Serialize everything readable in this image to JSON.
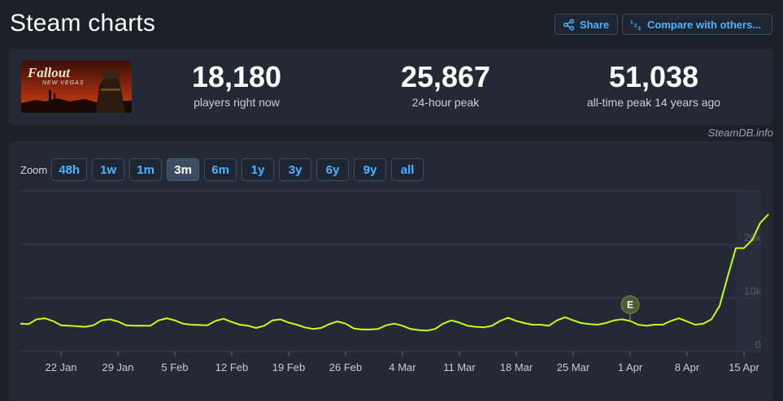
{
  "page": {
    "title": "Steam charts"
  },
  "header": {
    "share_label": "Share",
    "compare_label": "Compare with others..."
  },
  "game": {
    "cover_logo_text": "Fallout",
    "cover_sub_text": "NEW VEGAS"
  },
  "stats": [
    {
      "value": "18,180",
      "label": "players right now"
    },
    {
      "value": "25,867",
      "label": "24-hour peak"
    },
    {
      "value": "51,038",
      "label": "all-time peak 14 years ago"
    }
  ],
  "credit": "SteamDB.info",
  "zoom": {
    "label": "Zoom",
    "options": [
      "48h",
      "1w",
      "1m",
      "3m",
      "6m",
      "1y",
      "3y",
      "6y",
      "9y",
      "all"
    ],
    "active": "3m"
  },
  "colors": {
    "accent": "#4db3ff",
    "line": "#c6ff1a",
    "marker": "#4a5e32"
  },
  "chart_data": {
    "type": "line",
    "x_ticks": [
      "22 Jan",
      "29 Jan",
      "5 Feb",
      "12 Feb",
      "19 Feb",
      "26 Feb",
      "4 Mar",
      "11 Mar",
      "18 Mar",
      "25 Mar",
      "1 Apr",
      "8 Apr",
      "15 Apr"
    ],
    "y_ticks": [
      "0",
      "10k",
      "20k"
    ],
    "ylim": [
      0,
      30000
    ],
    "grid": true,
    "x_start": "2024-01-17",
    "series": [
      {
        "points": [
          [
            "2024-01-17",
            5200
          ],
          [
            "2024-01-18",
            5100
          ],
          [
            "2024-01-19",
            6000
          ],
          [
            "2024-01-20",
            6200
          ],
          [
            "2024-01-21",
            5700
          ],
          [
            "2024-01-22",
            4900
          ],
          [
            "2024-01-23",
            4800
          ],
          [
            "2024-01-25",
            4600
          ],
          [
            "2024-01-26",
            4900
          ],
          [
            "2024-01-27",
            5800
          ],
          [
            "2024-01-28",
            6000
          ],
          [
            "2024-01-29",
            5600
          ],
          [
            "2024-01-30",
            4900
          ],
          [
            "2024-01-31",
            4800
          ],
          [
            "2024-02-02",
            4800
          ],
          [
            "2024-02-03",
            5800
          ],
          [
            "2024-02-04",
            6200
          ],
          [
            "2024-02-05",
            5800
          ],
          [
            "2024-02-06",
            5200
          ],
          [
            "2024-02-07",
            5000
          ],
          [
            "2024-02-09",
            4900
          ],
          [
            "2024-02-10",
            5700
          ],
          [
            "2024-02-11",
            6100
          ],
          [
            "2024-02-12",
            5500
          ],
          [
            "2024-02-13",
            5000
          ],
          [
            "2024-02-14",
            4800
          ],
          [
            "2024-02-15",
            4400
          ],
          [
            "2024-02-16",
            4800
          ],
          [
            "2024-02-17",
            5800
          ],
          [
            "2024-02-18",
            6000
          ],
          [
            "2024-02-19",
            5400
          ],
          [
            "2024-02-20",
            5000
          ],
          [
            "2024-02-21",
            4500
          ],
          [
            "2024-02-22",
            4200
          ],
          [
            "2024-02-23",
            4400
          ],
          [
            "2024-02-24",
            5100
          ],
          [
            "2024-02-25",
            5600
          ],
          [
            "2024-02-26",
            5200
          ],
          [
            "2024-02-27",
            4300
          ],
          [
            "2024-02-28",
            4100
          ],
          [
            "2024-02-29",
            4100
          ],
          [
            "2024-03-01",
            4200
          ],
          [
            "2024-03-02",
            4900
          ],
          [
            "2024-03-03",
            5200
          ],
          [
            "2024-03-04",
            4800
          ],
          [
            "2024-03-05",
            4200
          ],
          [
            "2024-03-06",
            4000
          ],
          [
            "2024-03-07",
            3900
          ],
          [
            "2024-03-08",
            4200
          ],
          [
            "2024-03-09",
            5200
          ],
          [
            "2024-03-10",
            5800
          ],
          [
            "2024-03-11",
            5400
          ],
          [
            "2024-03-12",
            4800
          ],
          [
            "2024-03-13",
            4600
          ],
          [
            "2024-03-14",
            4500
          ],
          [
            "2024-03-15",
            4800
          ],
          [
            "2024-03-16",
            5700
          ],
          [
            "2024-03-17",
            6300
          ],
          [
            "2024-03-18",
            5700
          ],
          [
            "2024-03-19",
            5300
          ],
          [
            "2024-03-20",
            5000
          ],
          [
            "2024-03-21",
            5000
          ],
          [
            "2024-03-22",
            4800
          ],
          [
            "2024-03-23",
            5800
          ],
          [
            "2024-03-24",
            6400
          ],
          [
            "2024-03-25",
            5800
          ],
          [
            "2024-03-26",
            5300
          ],
          [
            "2024-03-27",
            5100
          ],
          [
            "2024-03-28",
            5000
          ],
          [
            "2024-03-29",
            5300
          ],
          [
            "2024-03-30",
            5800
          ],
          [
            "2024-03-31",
            6000
          ],
          [
            "2024-04-01",
            5700
          ],
          [
            "2024-04-02",
            5000
          ],
          [
            "2024-04-03",
            4800
          ],
          [
            "2024-04-04",
            5000
          ],
          [
            "2024-04-05",
            5000
          ],
          [
            "2024-04-06",
            5700
          ],
          [
            "2024-04-07",
            6200
          ],
          [
            "2024-04-08",
            5600
          ],
          [
            "2024-04-09",
            5000
          ],
          [
            "2024-04-10",
            5200
          ],
          [
            "2024-04-11",
            6000
          ],
          [
            "2024-04-12",
            8500
          ],
          [
            "2024-04-13",
            14000
          ],
          [
            "2024-04-14",
            19300
          ],
          [
            "2024-04-15",
            19300
          ],
          [
            "2024-04-16",
            20800
          ],
          [
            "2024-04-17",
            24000
          ],
          [
            "2024-04-18",
            25600
          ]
        ]
      }
    ],
    "annotations": [
      {
        "x": "2024-04-01",
        "y": 5700,
        "label": "E"
      }
    ]
  }
}
